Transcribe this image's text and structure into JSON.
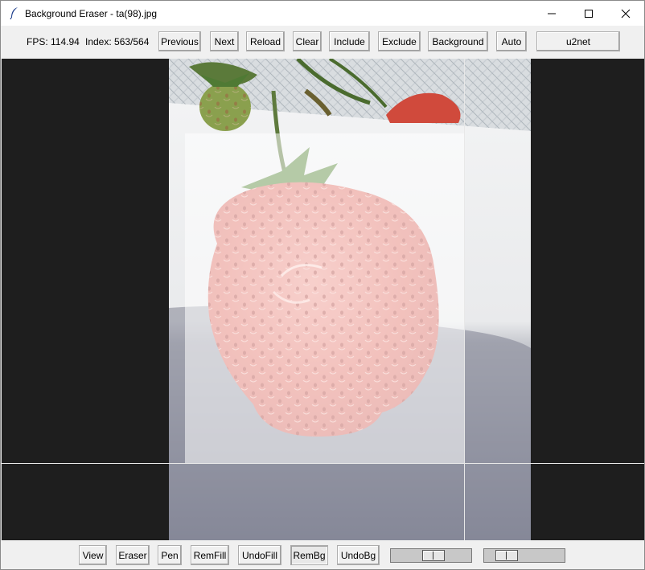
{
  "window": {
    "title": "Background Eraser - ta(98).jpg",
    "controls": {
      "minimize": "—",
      "maximize": "☐",
      "close": "✕"
    }
  },
  "status": {
    "fps": "FPS: 114.94",
    "index": "Index: 563/564"
  },
  "top_toolbar": [
    {
      "id": "previous",
      "label": "Previous"
    },
    {
      "id": "next",
      "label": "Next"
    },
    {
      "id": "reload",
      "label": "Reload"
    },
    {
      "id": "clear",
      "label": "Clear"
    },
    {
      "id": "include",
      "label": "Include"
    },
    {
      "id": "exclude",
      "label": "Exclude"
    },
    {
      "id": "background",
      "label": "Background"
    },
    {
      "id": "auto",
      "label": "Auto"
    },
    {
      "id": "model",
      "label": "u2net"
    }
  ],
  "bottom_toolbar": [
    {
      "id": "view",
      "label": "View"
    },
    {
      "id": "eraser",
      "label": "Eraser"
    },
    {
      "id": "pen",
      "label": "Pen"
    },
    {
      "id": "remfill",
      "label": "RemFill"
    },
    {
      "id": "undofill",
      "label": "UndoFill"
    },
    {
      "id": "rembg",
      "label": "RemBg",
      "pressed": true
    },
    {
      "id": "undobg",
      "label": "UndoBg"
    }
  ],
  "sliders": [
    {
      "id": "slider-1",
      "value": 0.55
    },
    {
      "id": "slider-2",
      "value": 0.2
    }
  ],
  "canvas": {
    "image_subject": "strawberry",
    "background_color": "#1e1e1e",
    "overlay_color": "#ffffff"
  },
  "colors": {
    "window_bg": "#f0f0f0",
    "strawberry": "#e07a70"
  }
}
